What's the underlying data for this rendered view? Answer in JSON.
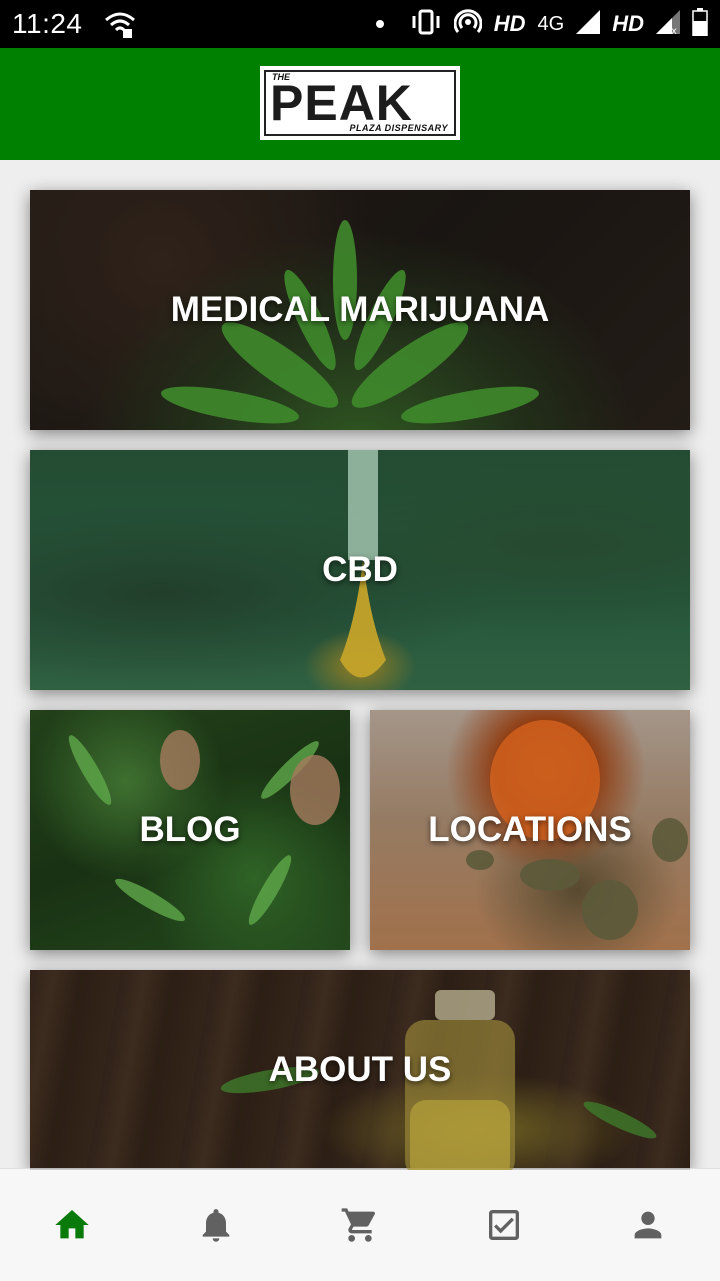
{
  "status_bar": {
    "time": "11:24",
    "hd1": "HD",
    "network": "4G",
    "hd2": "HD"
  },
  "header": {
    "logo": {
      "the": "THE",
      "main": "PEAK",
      "sub": "PLAZA DISPENSARY"
    },
    "background_color": "#008000"
  },
  "tiles": [
    {
      "label": "MEDICAL MARIJUANA"
    },
    {
      "label": "CBD"
    },
    {
      "label": "BLOG"
    },
    {
      "label": "LOCATIONS"
    },
    {
      "label": "ABOUT US"
    }
  ],
  "bottom_nav": {
    "items": [
      {
        "icon": "home-icon",
        "active": true
      },
      {
        "icon": "bell-icon",
        "active": false
      },
      {
        "icon": "cart-icon",
        "active": false
      },
      {
        "icon": "checkbox-icon",
        "active": false
      },
      {
        "icon": "person-icon",
        "active": false
      }
    ],
    "active_color": "#0a7a0a",
    "inactive_color": "#616161"
  }
}
